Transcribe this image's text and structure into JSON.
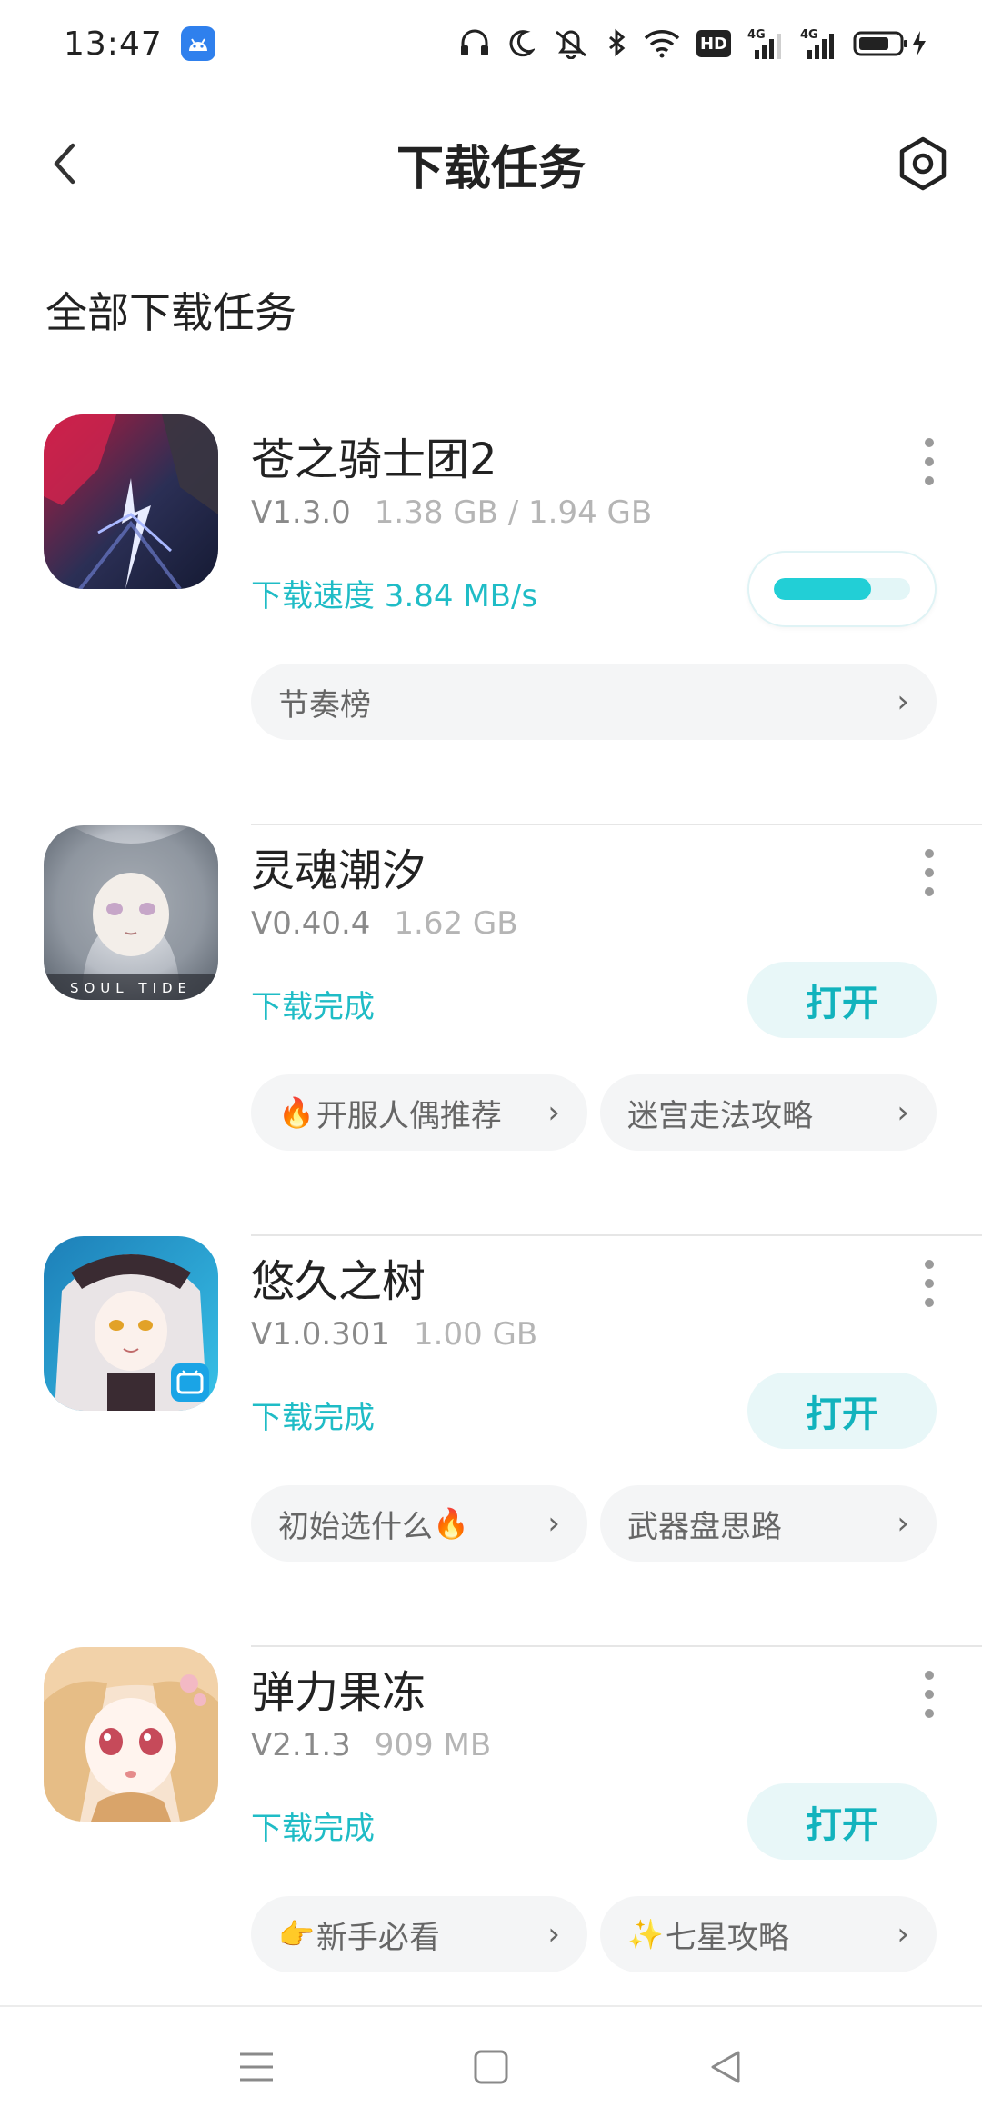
{
  "status_bar": {
    "time": "13:47",
    "icons": [
      "android-app-icon",
      "headset-icon",
      "moon-icon",
      "vibrate-mute-icon",
      "bluetooth-icon",
      "wifi-icon",
      "hd-icon",
      "4g-signal-icon",
      "4g-signal-icon",
      "battery-charging-icon"
    ],
    "hd_label": "HD",
    "net_label": "4G"
  },
  "header": {
    "title": "下载任务",
    "back_icon": "chevron-left-icon",
    "settings_icon": "settings-hexagon-icon"
  },
  "section_title": "全部下载任务",
  "tasks": [
    {
      "name": "苍之骑士团2",
      "version": "V1.3.0",
      "size": "1.38 GB / 1.94 GB",
      "status": "下载速度 3.84 MB/s",
      "progress": 0.71,
      "chips": [
        {
          "label": "节奏榜"
        }
      ],
      "colors": [
        "#b3193b",
        "#2b2f55",
        "#6a79c9"
      ]
    },
    {
      "name": "灵魂潮汐",
      "version": "V0.40.4",
      "size": "1.62 GB",
      "status": "下载完成",
      "button": "打开",
      "icon_caption": "SOUL TIDE",
      "chips": [
        {
          "emoji": "🔥",
          "label": "开服人偶推荐"
        },
        {
          "label": "迷宫走法攻略"
        }
      ],
      "colors": [
        "#d9dde2",
        "#6e7682",
        "#c6a6c8"
      ]
    },
    {
      "name": "悠久之树",
      "version": "V1.0.301",
      "size": "1.00 GB",
      "status": "下载完成",
      "button": "打开",
      "chips": [
        {
          "label": "初始选什么",
          "emoji_after": "🔥"
        },
        {
          "label": "武器盘思路"
        }
      ],
      "colors": [
        "#2a9fd6",
        "#e9e4e6",
        "#3a2b32"
      ]
    },
    {
      "name": "弹力果冻",
      "version": "V2.1.3",
      "size": "909 MB",
      "status": "下载完成",
      "button": "打开",
      "chips": [
        {
          "emoji": "👉",
          "label": "新手必看"
        },
        {
          "emoji": "✨",
          "label": "七星攻略"
        }
      ],
      "colors": [
        "#f7e3cf",
        "#d9a46a",
        "#c64a5a"
      ]
    }
  ],
  "chip_chevron": "›",
  "nav_bar": {
    "icons": [
      "menu-icon",
      "home-square-icon",
      "back-triangle-icon"
    ]
  },
  "accent_color": "#1fbcc6"
}
